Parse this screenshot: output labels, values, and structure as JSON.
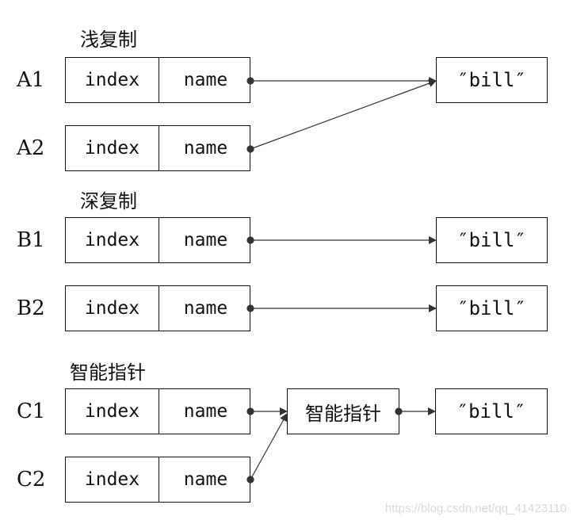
{
  "sections": {
    "shallow": {
      "title": "浅复制"
    },
    "deep": {
      "title": "深复制"
    },
    "smart": {
      "title": "智能指针"
    }
  },
  "rows": {
    "A1": {
      "label": "A1",
      "field1": "index",
      "field2": "name"
    },
    "A2": {
      "label": "A2",
      "field1": "index",
      "field2": "name"
    },
    "B1": {
      "label": "B1",
      "field1": "index",
      "field2": "name"
    },
    "B2": {
      "label": "B2",
      "field1": "index",
      "field2": "name"
    },
    "C1": {
      "label": "C1",
      "field1": "index",
      "field2": "name"
    },
    "C2": {
      "label": "C2",
      "field1": "index",
      "field2": "name"
    }
  },
  "values": {
    "a_shared": "″bill″",
    "b1": "″bill″",
    "b2": "″bill″",
    "c_shared": "″bill″"
  },
  "smart_pointer_box": "智能指针",
  "watermark": "https://blog.csdn.net/qq_41423110"
}
